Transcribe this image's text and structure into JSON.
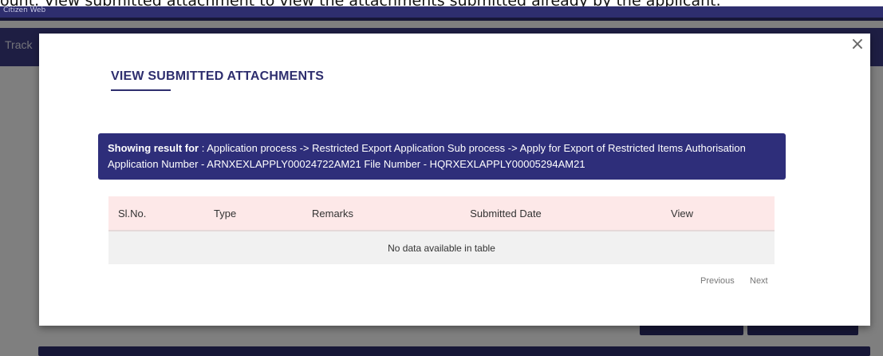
{
  "caption": "ount. View submitted attachment to view the attachments submitted already by the applicant.",
  "background": {
    "brand": "Citizen Web",
    "nav_label": "Track"
  },
  "modal": {
    "title": "VIEW SUBMITTED ATTACHMENTS",
    "close": "×",
    "banner": {
      "prefix": "Showing result for",
      "text": " : Application process -> Restricted Export Application Sub process -> Apply for Export of Restricted Items Authorisation Application Number - ARNXEXLAPPLY00024722AM21 File Number - HQRXEXLAPPLY00005294AM21"
    },
    "table": {
      "headers": [
        "Sl.No.",
        "Type",
        "Remarks",
        "Submitted Date",
        "View"
      ],
      "empty_message": "No data available in table"
    },
    "pagination": {
      "previous": "Previous",
      "next": "Next"
    }
  },
  "colors": {
    "brand_navy": "#2e2e6e",
    "banner": "#2e2e7a",
    "table_header": "#fde8e8"
  }
}
